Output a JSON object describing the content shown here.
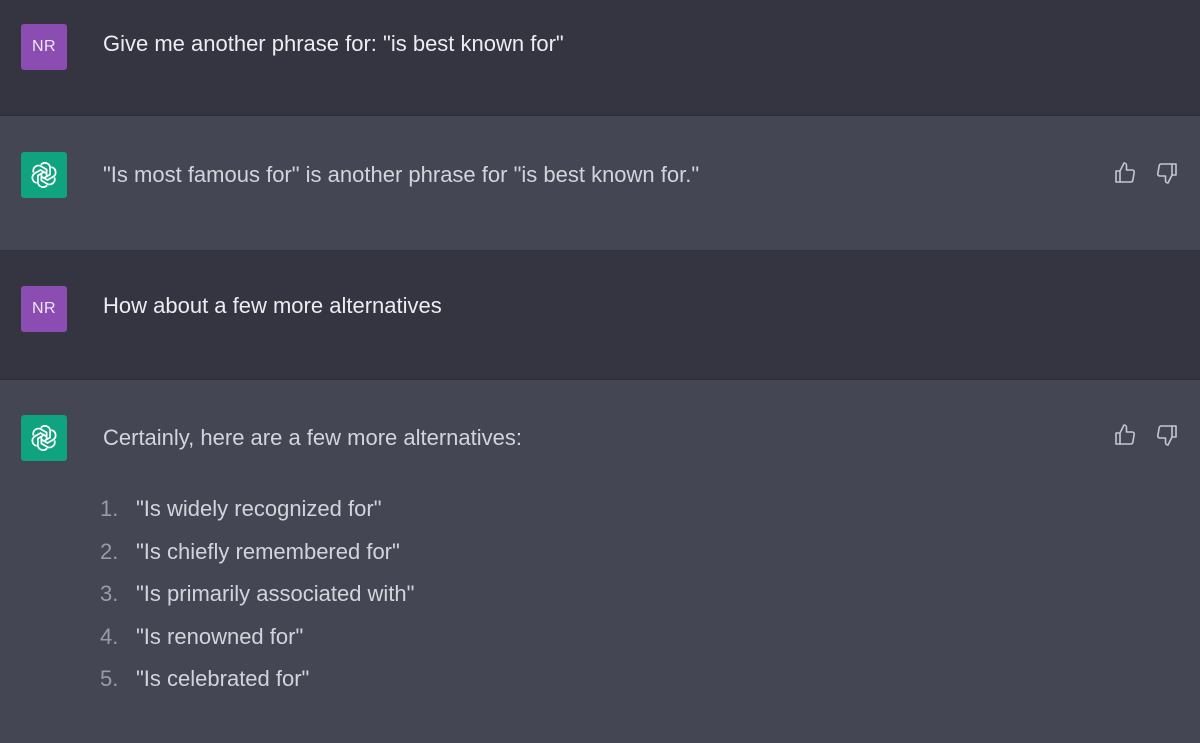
{
  "messages": [
    {
      "role": "user",
      "avatar_initials": "NR",
      "text": "Give me another phrase for: \"is best known for\""
    },
    {
      "role": "assistant",
      "avatar_icon": "openai-logo-icon",
      "text": "\"Is most famous for\" is another phrase for \"is best known for.\"",
      "feedback": [
        "thumbs-up-icon",
        "thumbs-down-icon"
      ]
    },
    {
      "role": "user",
      "avatar_initials": "NR",
      "text": "How about a few more alternatives"
    },
    {
      "role": "assistant",
      "avatar_icon": "openai-logo-icon",
      "text": "Certainly, here are a few more alternatives:",
      "list": [
        {
          "num": "1.",
          "text": "\"Is widely recognized for\""
        },
        {
          "num": "2.",
          "text": "\"Is chiefly remembered for\""
        },
        {
          "num": "3.",
          "text": "\"Is primarily associated with\""
        },
        {
          "num": "4.",
          "text": "\"Is renowned for\""
        },
        {
          "num": "5.",
          "text": "\"Is celebrated for\""
        }
      ],
      "feedback": [
        "thumbs-up-icon",
        "thumbs-down-icon"
      ]
    }
  ],
  "colors": {
    "user_bg": "#343541",
    "assistant_bg": "#444654",
    "user_avatar": "#8c4db3",
    "bot_avatar": "#10a37f"
  }
}
